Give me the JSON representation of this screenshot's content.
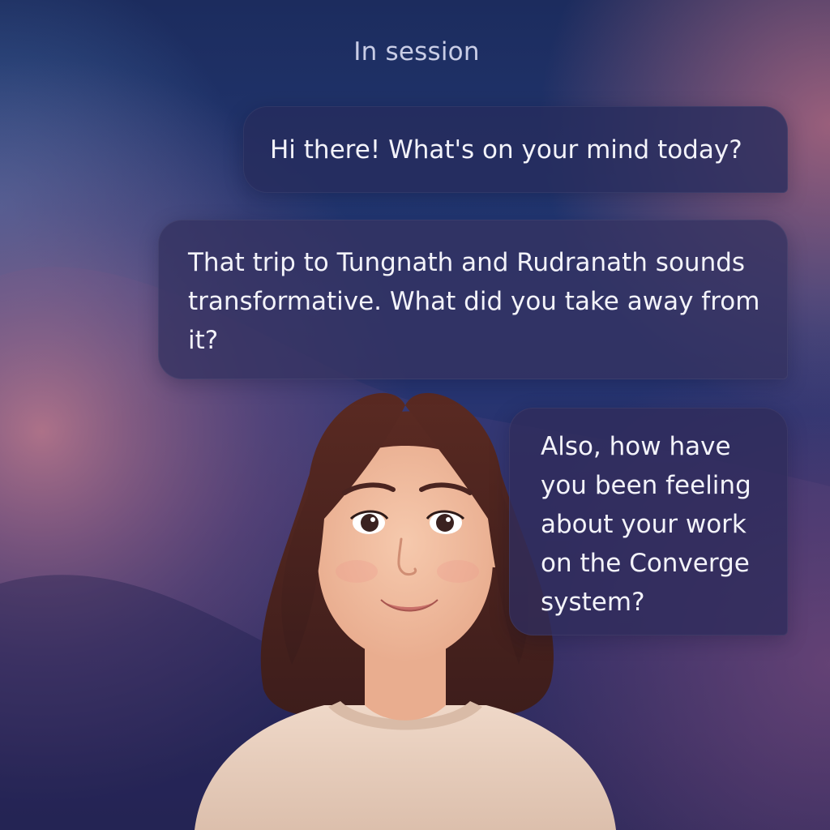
{
  "session": {
    "status_label": "In session"
  },
  "messages": [
    {
      "text": "Hi there! What's on your mind today?"
    },
    {
      "text": "That trip to Tungnath and Rudranath sounds transformative. What did you take away from it?"
    },
    {
      "text": "Also, how have you been feeling about your work on the Converge system?"
    }
  ],
  "colors": {
    "background_top": "#1b2a5e",
    "background_pink": "#b06a86",
    "bubble": "#262c5c",
    "text": "#f3f3fa",
    "status_text": "#c9cde6"
  },
  "icons": {
    "avatar": "therapist-avatar-illustration"
  }
}
